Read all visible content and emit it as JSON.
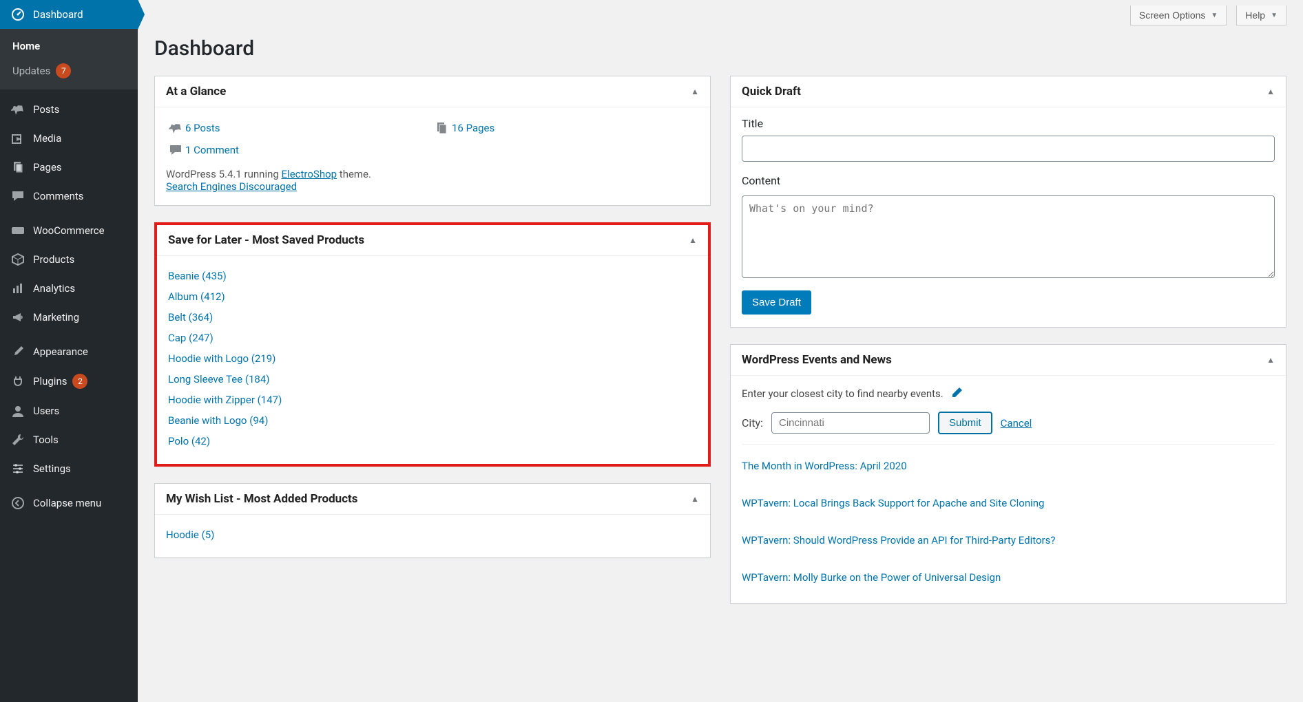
{
  "top": {
    "screen_options": "Screen Options",
    "help": "Help"
  },
  "page_title": "Dashboard",
  "sidebar": {
    "dashboard": {
      "label": "Dashboard"
    },
    "sub": {
      "home": "Home",
      "updates": "Updates",
      "updates_count": "7"
    },
    "items": [
      {
        "label": "Posts",
        "name": "posts",
        "icon": "pin"
      },
      {
        "label": "Media",
        "name": "media",
        "icon": "media"
      },
      {
        "label": "Pages",
        "name": "pages",
        "icon": "pages"
      },
      {
        "label": "Comments",
        "name": "comments",
        "icon": "comment"
      },
      {
        "label": "WooCommerce",
        "name": "woocommerce",
        "icon": "woo"
      },
      {
        "label": "Products",
        "name": "products",
        "icon": "box"
      },
      {
        "label": "Analytics",
        "name": "analytics",
        "icon": "chart"
      },
      {
        "label": "Marketing",
        "name": "marketing",
        "icon": "megaphone"
      },
      {
        "label": "Appearance",
        "name": "appearance",
        "icon": "brush"
      },
      {
        "label": "Plugins",
        "name": "plugins",
        "icon": "plug",
        "badge": "2"
      },
      {
        "label": "Users",
        "name": "users",
        "icon": "user"
      },
      {
        "label": "Tools",
        "name": "tools",
        "icon": "wrench"
      },
      {
        "label": "Settings",
        "name": "settings",
        "icon": "sliders"
      },
      {
        "label": "Collapse menu",
        "name": "collapse",
        "icon": "collapse"
      }
    ]
  },
  "glance": {
    "title": "At a Glance",
    "posts": "6 Posts",
    "pages": "16 Pages",
    "comments": "1 Comment",
    "wp_prefix": "WordPress 5.4.1 running ",
    "theme": "ElectroShop",
    "wp_suffix": " theme.",
    "seo": "Search Engines Discouraged"
  },
  "saved": {
    "title": "Save for Later - Most Saved Products",
    "items": [
      "Beanie (435)",
      "Album (412)",
      "Belt (364)",
      "Cap (247)",
      "Hoodie with Logo (219)",
      "Long Sleeve Tee (184)",
      "Hoodie with Zipper (147)",
      "Beanie with Logo (94)",
      "Polo (42)"
    ]
  },
  "wishlist": {
    "title": "My Wish List - Most Added Products",
    "items": [
      "Hoodie (5)"
    ]
  },
  "draft": {
    "title": "Quick Draft",
    "title_label": "Title",
    "content_label": "Content",
    "content_placeholder": "What's on your mind?",
    "save": "Save Draft"
  },
  "events": {
    "title": "WordPress Events and News",
    "intro": "Enter your closest city to find nearby events.",
    "city_label": "City:",
    "city_placeholder": "Cincinnati",
    "submit": "Submit",
    "cancel": "Cancel",
    "news": [
      "The Month in WordPress: April 2020",
      "WPTavern: Local Brings Back Support for Apache and Site Cloning",
      "WPTavern: Should WordPress Provide an API for Third-Party Editors?",
      "WPTavern: Molly Burke on the Power of Universal Design"
    ]
  }
}
